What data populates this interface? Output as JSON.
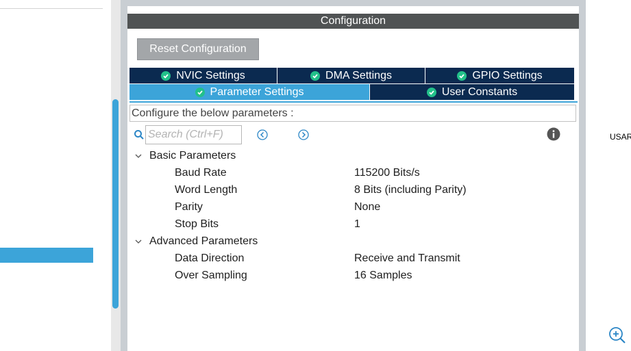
{
  "configuration": {
    "title": "Configuration",
    "reset_button": "Reset Configuration"
  },
  "tabs": {
    "row1": [
      {
        "label": "NVIC Settings",
        "icon": "check-circle-icon"
      },
      {
        "label": "DMA Settings",
        "icon": "check-circle-icon"
      },
      {
        "label": "GPIO Settings",
        "icon": "check-circle-icon"
      }
    ],
    "row2": [
      {
        "label": "Parameter Settings",
        "icon": "check-circle-icon",
        "active": true
      },
      {
        "label": "User Constants",
        "icon": "check-circle-icon"
      }
    ]
  },
  "description": "Configure the below parameters :",
  "search": {
    "placeholder": "Search (Ctrl+F)"
  },
  "parameters": {
    "basic": {
      "label": "Basic Parameters",
      "items": [
        {
          "name": "Baud Rate",
          "value": "115200 Bits/s"
        },
        {
          "name": "Word Length",
          "value": "8 Bits (including Parity)"
        },
        {
          "name": "Parity",
          "value": "None"
        },
        {
          "name": "Stop Bits",
          "value": "1"
        }
      ]
    },
    "advanced": {
      "label": "Advanced Parameters",
      "items": [
        {
          "name": "Data Direction",
          "value": "Receive and Transmit"
        },
        {
          "name": "Over Sampling",
          "value": "16 Samples"
        }
      ]
    }
  },
  "right_panel": {
    "label": "USAR"
  },
  "colors": {
    "header_bg": "#505354",
    "tab_bg": "#0b2a50",
    "tab_active": "#3ca4d9",
    "check_green": "#22c08a",
    "selection_blue": "#3ca4d9"
  }
}
